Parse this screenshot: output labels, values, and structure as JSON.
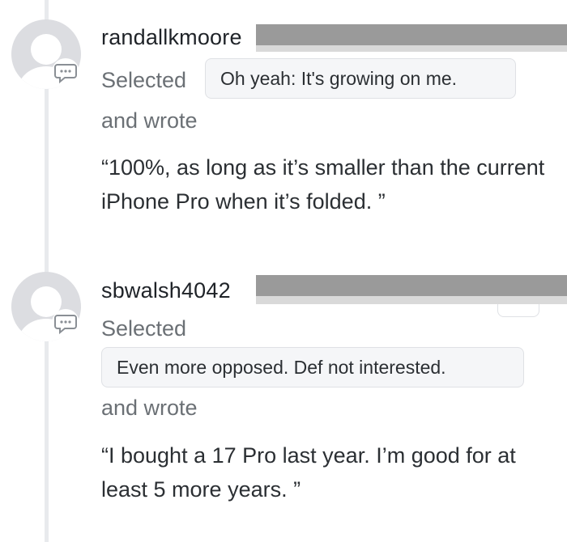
{
  "comments": [
    {
      "username": "randallkmoore",
      "selected_label": "Selected",
      "selection": "Oh yeah: It's growing on me.",
      "wrote_label": "and wrote",
      "quote": "“100%, as long as it’s smaller than the current iPhone Pro when it’s folded. ”"
    },
    {
      "username": "sbwalsh4042",
      "selected_label": "Selected",
      "selection": "Even more opposed. Def not interested.",
      "wrote_label": "and wrote",
      "quote": "“I bought a 17 Pro last year. I’m good for at least 5 more years. ”"
    }
  ],
  "icons": {
    "avatar": "default-user-avatar-icon",
    "comment": "speech-bubble-icon"
  },
  "colors": {
    "thread_line": "#e8eaed",
    "redaction": "#9a9a9a",
    "chip_bg": "#f5f6f8",
    "muted_text": "#6b7075"
  }
}
